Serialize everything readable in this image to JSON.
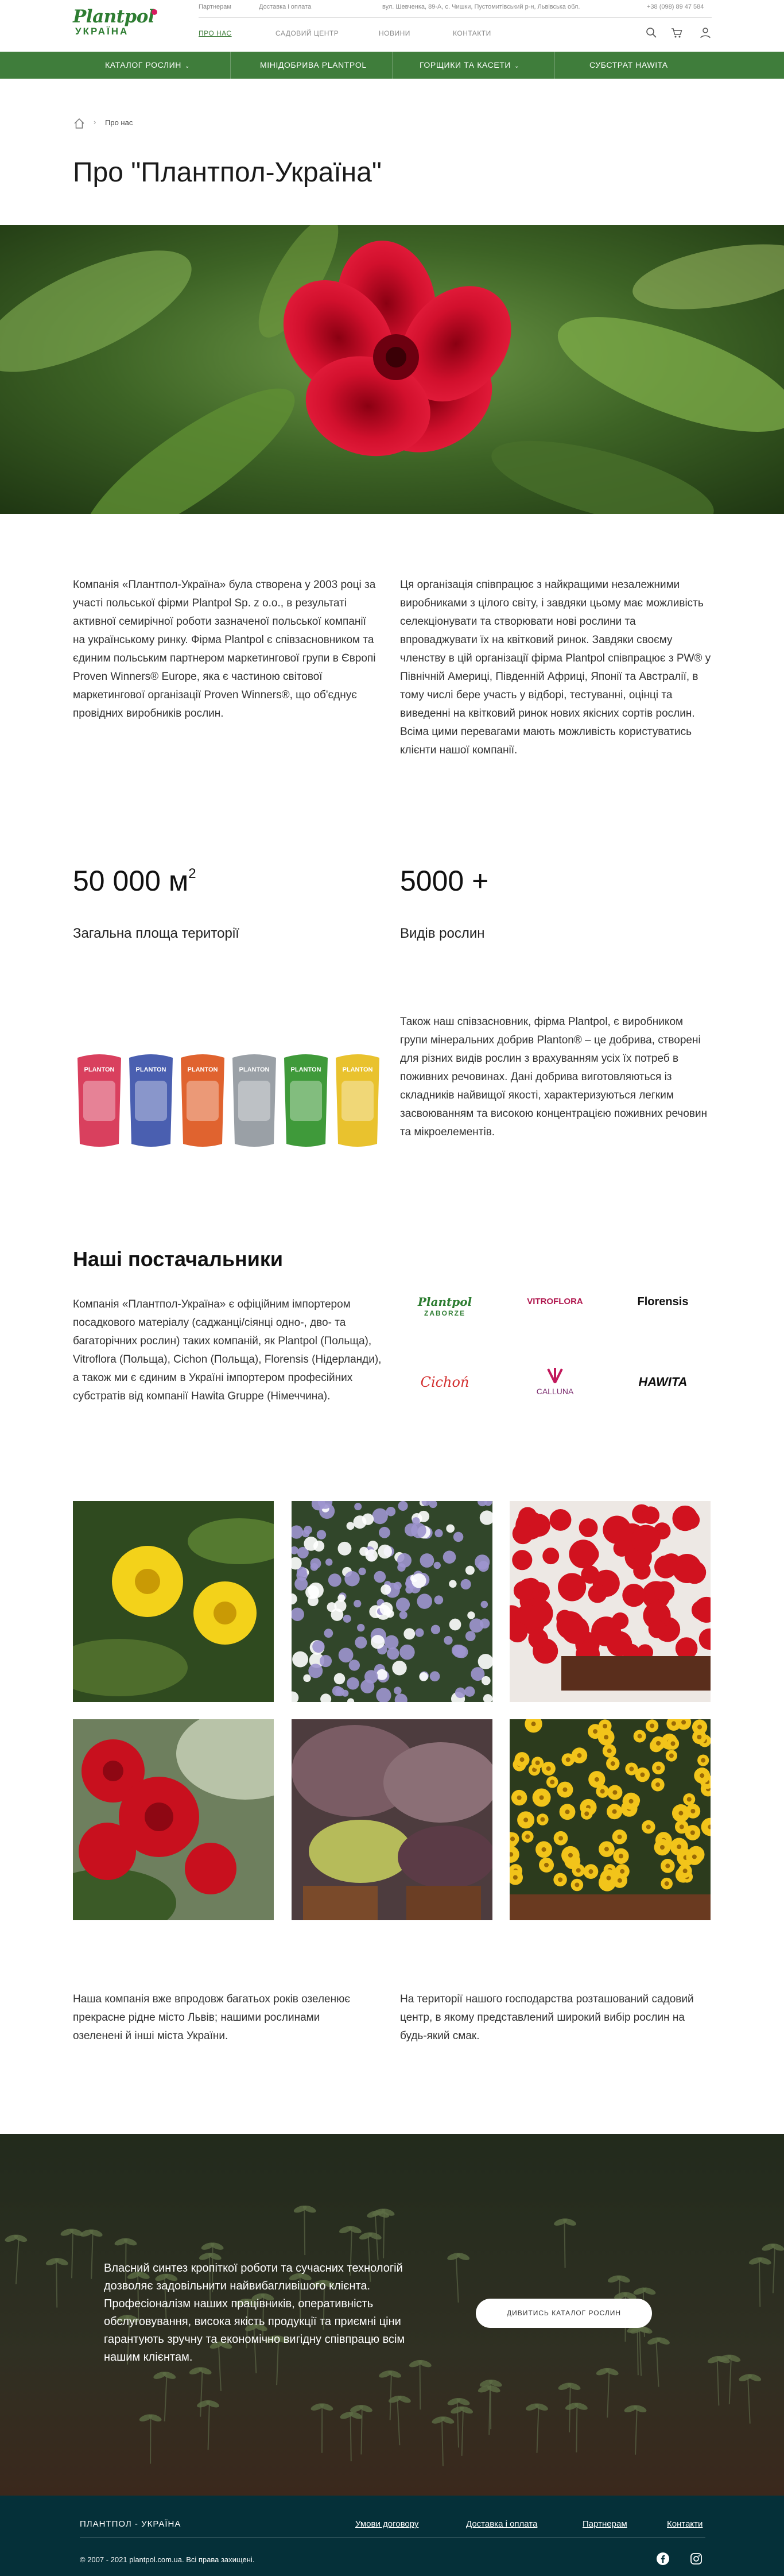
{
  "brand": {
    "logo_top": "Plantpol",
    "logo_bottom": "УКРАЇНА"
  },
  "utility_links": [
    "Партнерам",
    "Доставка і оплата",
    "вул. Шевченка, 89-А, с. Чишки, Пустомитівський р-н, Львівська обл.",
    "+38 (098) 89 47 584"
  ],
  "main_nav": [
    "Про нас",
    "Садовий центр",
    "Новини",
    "Контакти"
  ],
  "categories": [
    "Каталог рослин",
    "Мінідобрива Plantpol",
    "Горщики та касети",
    "Субстрат Hawita"
  ],
  "breadcrumb": {
    "current": "Про нас"
  },
  "page": {
    "title": "Про \"Плантпол-Україна\""
  },
  "about": {
    "left": "Компанія «Плантпол-Україна» була створена у 2003 році за участі польської фірми Plantpol Sp. z o.o., в результаті активної семирічної роботи зазначеної польської компанії на українському ринку. Фірма Plantpol є співзасновником та єдиним польським партнером маркетингової групи в Європі Proven Winners® Europe, яка є частиною світової маркетингової організації Proven Winners®, що об'єднує провідних виробників рослин.",
    "right": "Ця організація співпрацює з найкращими незалежними виробниками з цілого світу, і завдяки цьому має можливість селекціонувати та створювати нові рослини та впроваджувати їх на квітковий ринок. Завдяки своєму членству в цій організації фірма Plantpol співпрацює з PW® у Північній Америці, Південній Африці, Японії та Австралії, в тому числі бере участь у відборі, тестуванні, оцінці та виведенні на квітковий ринок нових якісних сортів рослин. Всіма цими перевагами мають можливість користуватись клієнти нашої компанії."
  },
  "stats": [
    {
      "value": "50 000 м",
      "sup": "2",
      "label": "Загальна площа території"
    },
    {
      "value": "5000 +",
      "sup": "",
      "label": "Видів рослин"
    }
  ],
  "fertilizer": {
    "text": "Також наш співзасновник, фірма Plantpol, є виробником групи мінеральних добрив Planton® – це добрива, створені для різних видів рослин з врахуванням усіх їх потреб в поживних речовинах. Дані добрива виготовляються із складників найвищої якості, характеризуються легким засвоюванням та високою концентрацією поживних речовин та мікроелементів.",
    "pack_labels": [
      "PLANTON",
      "PLANTON",
      "PLANTON",
      "PLANTON",
      "PLANTON",
      "PLANTON"
    ],
    "pack_colors": [
      "#d9405e",
      "#4a5fb0",
      "#e0632f",
      "#9aa0a6",
      "#3f9a3a",
      "#e9c22e"
    ]
  },
  "suppliers": {
    "title": "Наші постачальники",
    "text": "Компанія «Плантпол-Україна» є офіційним імпортером посадкового матеріалу (саджанці/сіянці одно-, дво- та багаторічних рослин) таких компаній, як Plantpol (Польща), Vitroflora (Польща), Cichon (Польща), Florensis (Нідерланди), а також ми є єдиним в Україні імпортером професійних субстратів від компанії Hawita Gruppe (Німеччина).",
    "logos": [
      {
        "name": "plantpol-zaborze",
        "line1": "Plantpol",
        "line2": "ZABORZE",
        "color": "#2e7d32"
      },
      {
        "name": "vitroflora",
        "line1": "VITROFLORA",
        "line2": "",
        "color": "#b0184f"
      },
      {
        "name": "florensis",
        "line1": "Florensis",
        "line2": "",
        "color": "#111111"
      },
      {
        "name": "cichon",
        "line1": "Cichoń",
        "line2": "",
        "color": "#d32f2f"
      },
      {
        "name": "calluna",
        "line1": "CALLUNA",
        "line2": "",
        "color": "#7b2d6f"
      },
      {
        "name": "hawita",
        "line1": "HAWITA",
        "line2": "",
        "color": "#111111"
      }
    ]
  },
  "gallery": [
    "yellow-flowers-photo",
    "lilac-flowers-photo",
    "red-petunia-photo",
    "red-geranium-photo",
    "heuchera-photo",
    "yellow-bidens-photo"
  ],
  "closing": {
    "left": "Наша компанія вже впродовж багатьох років озеленює прекрасне рідне місто Львів; нашими рослинами озеленені й інші міста України.",
    "right": "На території нашого господарства розташований садовий центр, в якому представлений широкий вибір рослин на будь-який смак."
  },
  "cta": {
    "text": "Власний синтез кропіткої роботи та сучасних технологій дозволяє задовільнити найвибагливішого клієнта. Професіоналізм наших працівників, оперативність обслуговування, висока якість продукції та приємні ціни гарантують зручну та економічно вигідну співпрацю всім нашим клієнтам.",
    "button": "Дивитись каталог рослин"
  },
  "footer": {
    "brand": "ПЛАНТПОЛ - УКРАЇНА",
    "links": [
      "Умови договору",
      "Доставка і оплата",
      "Партнерам",
      "Контакти"
    ],
    "copyright": "© 2007 - 2021 plantpol.com.ua. Всі права захищені."
  },
  "colors": {
    "brand_green": "#3f7d3b",
    "footer_bg": "#053039",
    "accent_pink": "#d81b60"
  },
  "icons": [
    "search-icon",
    "cart-icon",
    "user-icon",
    "home-icon",
    "facebook-icon",
    "instagram-icon",
    "chevron-down-icon"
  ]
}
